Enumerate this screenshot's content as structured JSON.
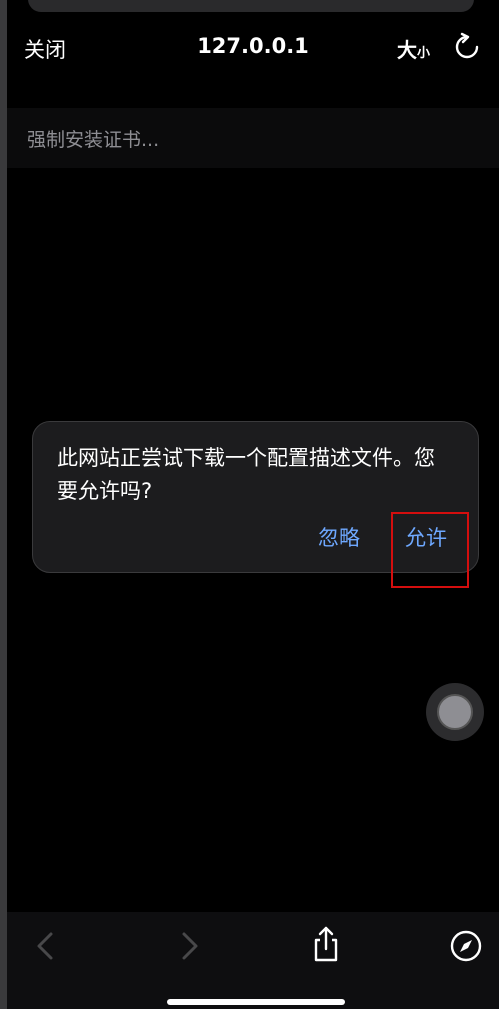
{
  "nav": {
    "close_label": "关闭",
    "title": "127.0.0.1",
    "size_big": "大",
    "size_small": "小",
    "refresh_icon": "refresh-icon"
  },
  "page": {
    "status_text": "强制安装证书..."
  },
  "dialog": {
    "message": "此网站正尝试下载一个配置描述文件。您要允许吗?",
    "ignore_label": "忽略",
    "allow_label": "允许"
  },
  "toolbar": {
    "icons": [
      "back-chevron-icon",
      "forward-chevron-icon",
      "share-icon",
      "compass-icon"
    ]
  },
  "colors": {
    "background": "#000000",
    "accent": "#6ea8ff",
    "highlight": "#d40e0e"
  }
}
